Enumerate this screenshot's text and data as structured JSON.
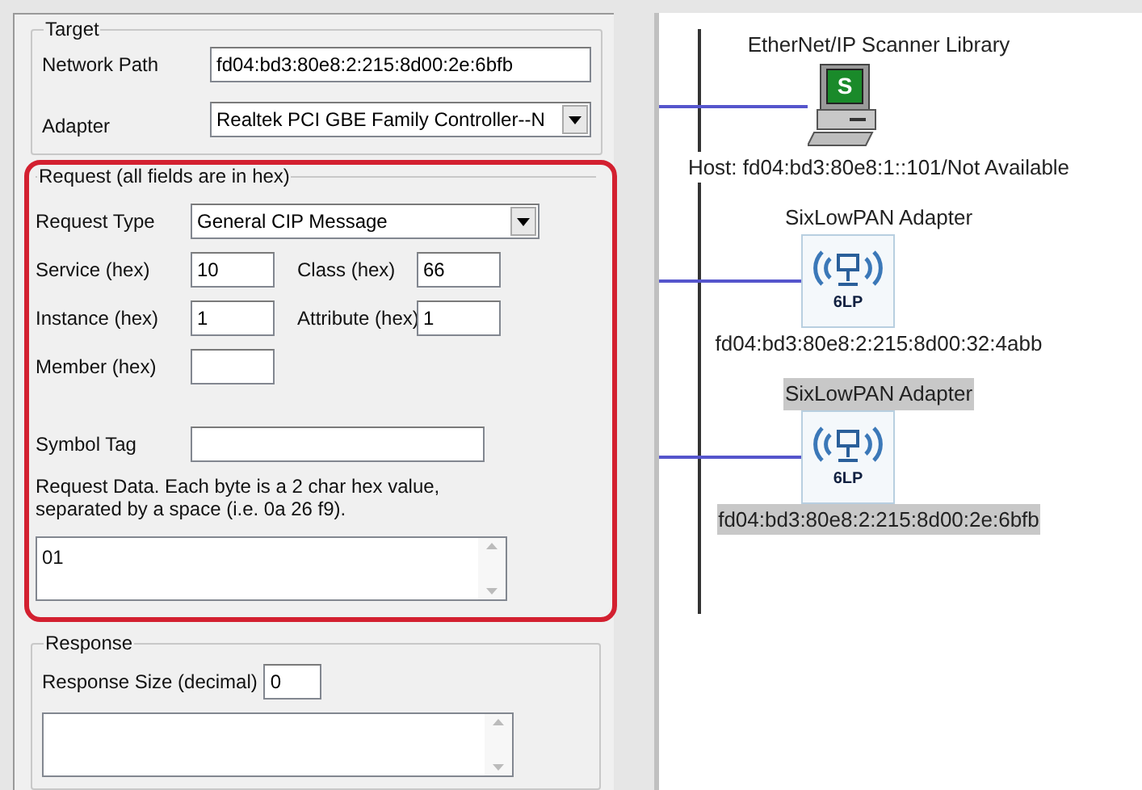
{
  "target": {
    "legend": "Target",
    "network_path": {
      "label": "Network Path",
      "value": "fd04:bd3:80e8:2:215:8d00:2e:6bfb"
    },
    "adapter": {
      "label": "Adapter",
      "value": "Realtek PCI GBE Family Controller--N"
    }
  },
  "request": {
    "legend": "Request (all fields are in hex)",
    "highlighted": true,
    "request_type": {
      "label": "Request Type",
      "value": "General CIP Message"
    },
    "fields": [
      {
        "label": "Service (hex)",
        "value": "10"
      },
      {
        "label": "Class (hex)",
        "value": "66"
      },
      {
        "label": "Instance (hex)",
        "value": "1"
      },
      {
        "label": "Attribute (hex)",
        "value": "1"
      },
      {
        "label": "Member (hex)"
      }
    ],
    "symbol_tag": {
      "label": "Symbol Tag"
    },
    "data_hint": "Request Data. Each byte is a 2 char hex value, separated by a space (i.e. 0a 26 f9).",
    "data_value": "01"
  },
  "response": {
    "legend": "Response",
    "size_label": "Response Size (decimal)",
    "size_value": "0"
  },
  "nodes": [
    {
      "kind": "computer",
      "title": "EtherNet/IP Scanner Library",
      "icon_text": "S",
      "address": "Host: fd04:bd3:80e8:1::101/Not Available",
      "selected": false
    },
    {
      "kind": "adapter",
      "title": "SixLowPAN Adapter",
      "icon_text": "6LP",
      "address": "fd04:bd3:80e8:2:215:8d00:32:4abb",
      "selected": false
    },
    {
      "kind": "adapter",
      "title": "SixLowPAN Adapter",
      "icon_text": "6LP",
      "address": "fd04:bd3:80e8:2:215:8d00:2e:6bfb",
      "selected": true
    }
  ]
}
